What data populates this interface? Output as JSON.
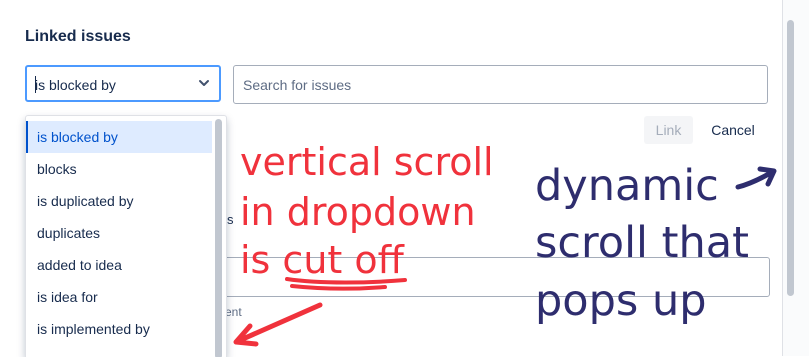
{
  "dialog": {
    "title": "Linked issues",
    "link_type_select": {
      "value": "is blocked by",
      "options": [
        "is blocked by",
        "blocks",
        "is duplicated by",
        "duplicates",
        "added to idea",
        "is idea for",
        "is implemented by"
      ]
    },
    "search": {
      "placeholder": "Search for issues",
      "value": ""
    },
    "link_button": "Link",
    "cancel_button": "Cancel",
    "hint_partial": "ent"
  },
  "annotations": {
    "red_lines": [
      "vertical scroll",
      "in dropdown",
      "is cut off"
    ],
    "blue_lines": [
      "dynamic",
      "scroll that",
      "pops up"
    ],
    "red_color": "#f0323c",
    "blue_color": "#2e2d6e"
  },
  "colors": {
    "focus_border": "#4c9aff",
    "selected_bg": "#deebff",
    "selected_text": "#0052cc"
  }
}
